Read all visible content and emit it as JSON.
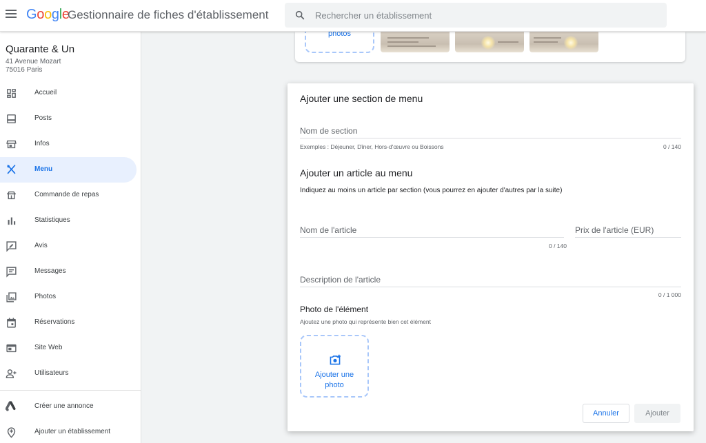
{
  "header": {
    "logo": [
      "G",
      "o",
      "o",
      "g",
      "l",
      "e"
    ],
    "product_name": "Gestionnaire de fiches d'établissement",
    "search_placeholder": "Rechercher un établissement"
  },
  "business": {
    "name": "Quarante & Un",
    "address_line1": "41 Avenue Mozart",
    "address_line2": "75016 Paris"
  },
  "sidebar": {
    "items": [
      {
        "label": "Accueil",
        "icon": "dashboard-icon"
      },
      {
        "label": "Posts",
        "icon": "posts-icon"
      },
      {
        "label": "Infos",
        "icon": "storefront-icon"
      },
      {
        "label": "Menu",
        "icon": "fork-knife-icon",
        "active": true
      },
      {
        "label": "Commande de repas",
        "icon": "food-order-icon"
      },
      {
        "label": "Statistiques",
        "icon": "bar-chart-icon"
      },
      {
        "label": "Avis",
        "icon": "reviews-icon"
      },
      {
        "label": "Messages",
        "icon": "messages-icon"
      },
      {
        "label": "Photos",
        "icon": "photos-icon"
      },
      {
        "label": "Réservations",
        "icon": "calendar-icon"
      },
      {
        "label": "Site Web",
        "icon": "website-icon"
      },
      {
        "label": "Utilisateurs",
        "icon": "add-user-icon"
      }
    ],
    "footer_items": [
      {
        "label": "Créer une annonce",
        "icon": "ads-icon"
      },
      {
        "label": "Ajouter un établissement",
        "icon": "add-location-icon"
      }
    ]
  },
  "photo_card": {
    "add_label": "photos"
  },
  "dialog": {
    "title": "Ajouter une section de menu",
    "section_name": {
      "label": "Nom de section",
      "helper": "Exemples : Déjeuner, Dîner, Hors-d'œuvre ou Boissons",
      "counter": "0 / 140"
    },
    "item_heading": "Ajouter un article au menu",
    "item_description": "Indiquez au moins un article par section (vous pourrez en ajouter d'autres par la suite)",
    "item_name": {
      "label": "Nom de l'article",
      "counter": "0 / 140"
    },
    "item_price": {
      "label": "Prix de l'article (EUR)"
    },
    "item_desc_field": {
      "label": "Description de l'article",
      "counter": "0 / 1 000"
    },
    "photo": {
      "title": "Photo de l'élément",
      "description": "Ajoutez une photo qui représente bien cet élément",
      "add_label": "Ajouter une photo"
    },
    "cancel_label": "Annuler",
    "add_label": "Ajouter"
  },
  "colors": {
    "accent": "#1a73e8",
    "active_bg": "#e8f0fe"
  }
}
